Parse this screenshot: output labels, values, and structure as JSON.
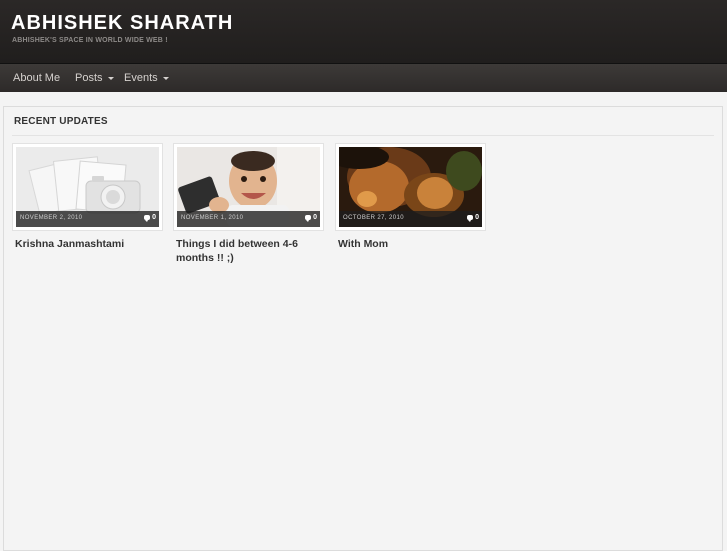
{
  "site": {
    "title": "ABHISHEK SHARATH",
    "description": "ABHISHEK'S SPACE IN WORLD WIDE WEB !"
  },
  "nav": {
    "items": [
      {
        "label": "About Me",
        "has_dropdown": false
      },
      {
        "label": "Posts",
        "has_dropdown": true
      },
      {
        "label": "Events",
        "has_dropdown": true
      }
    ]
  },
  "recent": {
    "heading": "RECENT UPDATES",
    "posts": [
      {
        "date": "NOVEMBER 2, 2010",
        "comments": "0",
        "title": "Krishna Janmashtami",
        "thumb_icon": "placeholder-camera-icon"
      },
      {
        "date": "NOVEMBER 1, 2010",
        "comments": "0",
        "title": "Things I did between 4-6 months !! ;)",
        "thumb_icon": "baby-photo"
      },
      {
        "date": "OCTOBER 27, 2010",
        "comments": "0",
        "title": "With Mom",
        "thumb_icon": "mom-baby-photo"
      }
    ]
  },
  "colors": {
    "header_bg": "#252221",
    "nav_bg": "#353231",
    "page_bg": "#f4f4f4",
    "title_text": "#333333"
  }
}
